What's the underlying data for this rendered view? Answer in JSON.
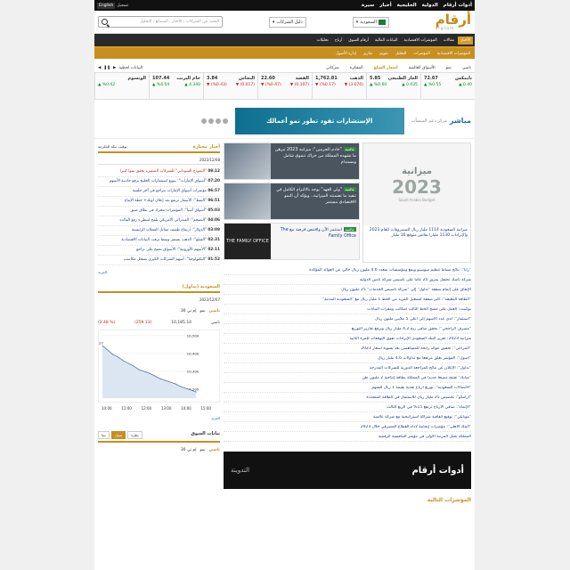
{
  "topbar": {
    "links": [
      "أدوات أرقام",
      "الدولية",
      "الخليجية",
      "أخبار",
      "سيرة"
    ],
    "lang_en": "English",
    "lang_ar": "تسجيل"
  },
  "header": {
    "logo_ar": "أرقام",
    "logo_en": "argaam",
    "market": "السعودية",
    "directory": "دليل الشركات",
    "search_placeholder": "البحث عن الشركات ، الأخبار ، المصانع ، التحليل"
  },
  "nav": [
    "الأخبار",
    "مقالات",
    "المؤشرات الاقتصادية",
    "البيانات المالية",
    "أرقام السوق",
    "أرباح",
    "تحليلات",
    "المؤشرات الاقتصادية",
    "المؤشرات",
    "التحليل",
    "تقويم",
    "تقارير",
    "إدارة الأصول"
  ],
  "tickers": {
    "tabs": [
      "تاسي",
      "نمو",
      "الأسواق العالمية",
      "أسعار السلع",
      "المفكرة",
      "شركاتي"
    ],
    "extra": "البيانات لحظية",
    "items": [
      {
        "name": "نايمكس",
        "price": "72.67",
        "chg": "0.40 ▲",
        "pct": "%0.55 ▲"
      },
      {
        "name": "الغاز الطبيعي",
        "price": "5.85",
        "chg": "0.035 ▲",
        "pct": "%0.60 ▲"
      },
      {
        "name": "الذهب",
        "price": "1,762.81",
        "chg": "(3.070) ▼",
        "pct": "(%0.17) ▼"
      },
      {
        "name": "الفضة",
        "price": "22.60",
        "chg": "(0.107) ▼",
        "pct": "(%0.47) ▼"
      },
      {
        "name": "النحاس",
        "price": "3.84",
        "chg": "(0.017) ▼",
        "pct": "(%0.43) ▼"
      },
      {
        "name": "خام البرنت",
        "price": "107.44",
        "chg": "4.340 ▲",
        "pct": "%4.04 ▲"
      },
      {
        "name": "الونسوم",
        "price": "",
        "chg": "",
        "pct": "%0.42 ▲"
      }
    ]
  },
  "banner": {
    "mobasher": "مباشر",
    "mobasher_sub": "مركز دعم المنشآت",
    "ad_text": "الإستشارات تقود تطور نمو أعمالك",
    "social": [
      "facebook",
      "twitter",
      "youtube",
      "instagram"
    ]
  },
  "hero": {
    "budget_num": "2023",
    "budget_ttl": "ميزانية",
    "budget_sub": "Saudi Arabia Budget",
    "budget_cap": "ميزانية السعودية 1114 مليار ريال للمصروفات للعام 2023 والإيرادات 1130 مليارا بفائض متوقع 16 مليار",
    "stories": [
      {
        "tag": "عالمية",
        "text": "\"خادم الحرمين\": ميزانية 2023 تبرهن ما تشهده المملكة من حراك تنموي شامل ومستدام"
      },
      {
        "tag": "عالمية",
        "text": "\"ولي العهد\" يوجه بالالتزام الكامل في تنفيذ ما تضمنته الميزانية.. ويؤكد أن النمو الاقتصادي مستمر"
      },
      {
        "tag": "عالمية",
        "text": "استثمر الآن واقتنص فرصة مع The Family Office"
      }
    ]
  },
  "newslist": [
    {
      "t": "\"رأيا\": نتائج نشاط تنظيم سوسيو ويمع ومؤسسات متعدد 4.6 مليون ريال حالي عن العوائد المؤكدة"
    },
    {
      "t": "شركة تاسك تحتفل بمرور 25 عاما على تأسيس شركة تأمين الدولية"
    },
    {
      "t": "الإتفاق على إتمام صفقة \"تداول\" إلى \"شركة تأسيس الخدمات\" 25 مليون ريال"
    },
    {
      "t": "\"الطاقة النظيفة\": أكبر صفقة لتشغيل المزيد من الخط 1 مليار ريال مع \"السعودية المدنية\""
    },
    {
      "t": "بوكبيت: العمل على مسح الخط الثالث لمكاتب ومقرات البيانات"
    },
    {
      "t": "\"استثمار\": لدي عدد الأسهم إلى أعلى 5 ملايين مليون ريال"
    },
    {
      "t": "\"مصرف الراجحي\": يحقق صافي ربح 4.2 مليار ريال ويرفع تقارير التوزيع"
    },
    {
      "t": "ميزانية 2023: تقرير البنك السعودي الإيرادات تفوق التوقعات للمرة الثانية"
    },
    {
      "t": "\"المراعي\": تحقيق عوائد رابحة للمساهمين بعد تسوية أسعار 2023"
    },
    {
      "t": "\"أصول\": المؤشر يغلق مرتفعا مع تداولات 4.6 مليار ريال"
    },
    {
      "t": "\"تداول\": الإعلان عن نتائج المراجعة الدورية للشركات المدرجة"
    },
    {
      "t": "\"سابك\" تفتتح مصنعا جديدا في المملكة بطاقة إنتاجية 2 مليون طن"
    },
    {
      "t": "\"الاتصالات السعودية\": توزيع أرباح نقدية بقيمة 1 ريال للسهم"
    },
    {
      "t": "\"أرامكو\": تخصيص 25 مليار ريال للاستثمار في الطاقة المتجددة"
    },
    {
      "t": "\"الإنماء\": صافي الأرباح ترتفع 15% في الربع الثالث"
    },
    {
      "t": "\"موبايلي\": توقيع اتفاقية شراكة استراتيجية مع شركة عالمية"
    },
    {
      "t": "\"البنك الأهلي\": مؤشرات إيجابية لأداء القطاع المصرفي خلال 2023"
    },
    {
      "t": "المملكة تحتل المرتبة الأولى في مؤشر التنافسية الرقمية"
    }
  ],
  "adbox": {
    "a": "أدوات أرقام",
    "b": "التدوينة"
  },
  "mosh_title": "المؤشرات التالية",
  "mnews": {
    "title": "أخبار مختارة",
    "sub": "توقيت مكة المكرمة",
    "date": "2022/12/08",
    "items": [
      {
        "tm": "08:12",
        "tx": "\"النموذج السوداني\" للشركات الصغيرة يحقق نموا كبيرا",
        "red": true
      },
      {
        "tm": "07:20",
        "tx": "\"أسواق الإمارات\": تنويع استثمارات الخليج يرفع جاذبية الأسهم"
      },
      {
        "tm": "06:57",
        "tx": "مؤشرات أسواق الإمارات تتراجع في آخر جلسة"
      },
      {
        "tm": "06:51",
        "tx": "\"النفط\": الأسعار ترتفع بعد إعلان أوبك+ خطة الإنتاج"
      },
      {
        "tm": "05:03",
        "tx": "\"أسواق آسيا\": المؤشرات تتحرك في نطاق ضيق"
      },
      {
        "tm": "04:06",
        "tx": "\"التضخم\": الفيدرالي الأمريكي يلمح لتبطيء رفع الفائدة"
      },
      {
        "tm": "03:09",
        "tx": "\"الدولار\": ارتفاع طفيف مقابل العملات الرئيسية"
      },
      {
        "tm": "02:31",
        "tx": "\"السلع\": الذهب يستقر وسط ترقب البيانات الاقتصادية"
      },
      {
        "tm": "02:11",
        "tx": "\"الأسهم الأوروبية\": الأسواق تفتتح على تراجع"
      },
      {
        "tm": "01:52",
        "tx": "\"التكنولوجيا\": أسهم الشركات الكبرى تسجل مكاسب"
      }
    ],
    "more": "المزيد"
  },
  "market": {
    "title": "السعودية (تداول)",
    "date": "2022/12/07",
    "segs": [
      "تاسي",
      "نمو",
      "إم تي 30"
    ],
    "idx_name": "تاسي",
    "idx_value": "10,185.14",
    "idx_chg": "(259.13)",
    "idx_pct": "(% 2.48)",
    "more": "المزيد"
  },
  "chart_data": {
    "type": "area",
    "x": [
      "10:00",
      "11:00",
      "12:00",
      "13:00",
      "14:00",
      "15:00"
    ],
    "values": [
      10444.27,
      10420,
      10395,
      10380,
      10360,
      10345,
      10330,
      10310,
      10300,
      10290,
      10275,
      10260,
      10250,
      10240,
      10230,
      10215,
      10205,
      10195,
      10185
    ],
    "yticks": [
      "10,500",
      "10,400",
      "10,300",
      "10,200"
    ],
    "ylim": [
      10150,
      10500
    ],
    "start_label": "10444.27",
    "title": "",
    "xlabel": "",
    "ylabel": ""
  },
  "market2": {
    "title": "بيانات السوق",
    "pills": [
      "نظرة",
      "صول",
      "بيتا"
    ],
    "segs": [
      "تاسي",
      "نمو",
      "إم تي 30"
    ]
  }
}
